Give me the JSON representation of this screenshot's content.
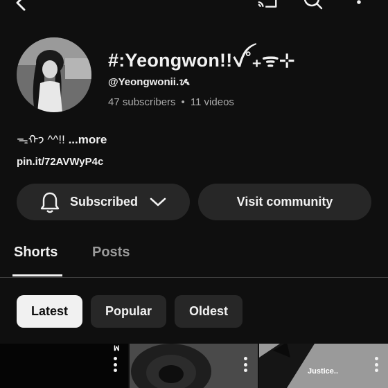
{
  "topbar": {
    "back_icon": "back-arrow-icon",
    "icons": [
      "cast-icon",
      "search-icon",
      "more-vert-icon"
    ]
  },
  "channel": {
    "name": "#:Yeongwon!!ꪜ˚₊ᯤ⊹",
    "handle": "@Yeongwonii.ᝰ",
    "subscribers": "47 subscribers",
    "separator": "•",
    "videos": "11 videos",
    "description": "ᯓᡣ𐭩 ^^!!",
    "more_label": "...more",
    "link": "pin.it/72AVWyP4c"
  },
  "actions": {
    "subscribed_label": "Subscribed",
    "community_label": "Visit community"
  },
  "tabs": [
    {
      "label": "Shorts",
      "active": true
    },
    {
      "label": "Posts",
      "active": false
    }
  ],
  "filters": [
    {
      "label": "Latest",
      "selected": true
    },
    {
      "label": "Popular",
      "selected": false
    },
    {
      "label": "Oldest",
      "selected": false
    }
  ],
  "thumbnails": [
    {
      "caption": ""
    },
    {
      "caption": ""
    },
    {
      "caption": "Justice.."
    }
  ]
}
